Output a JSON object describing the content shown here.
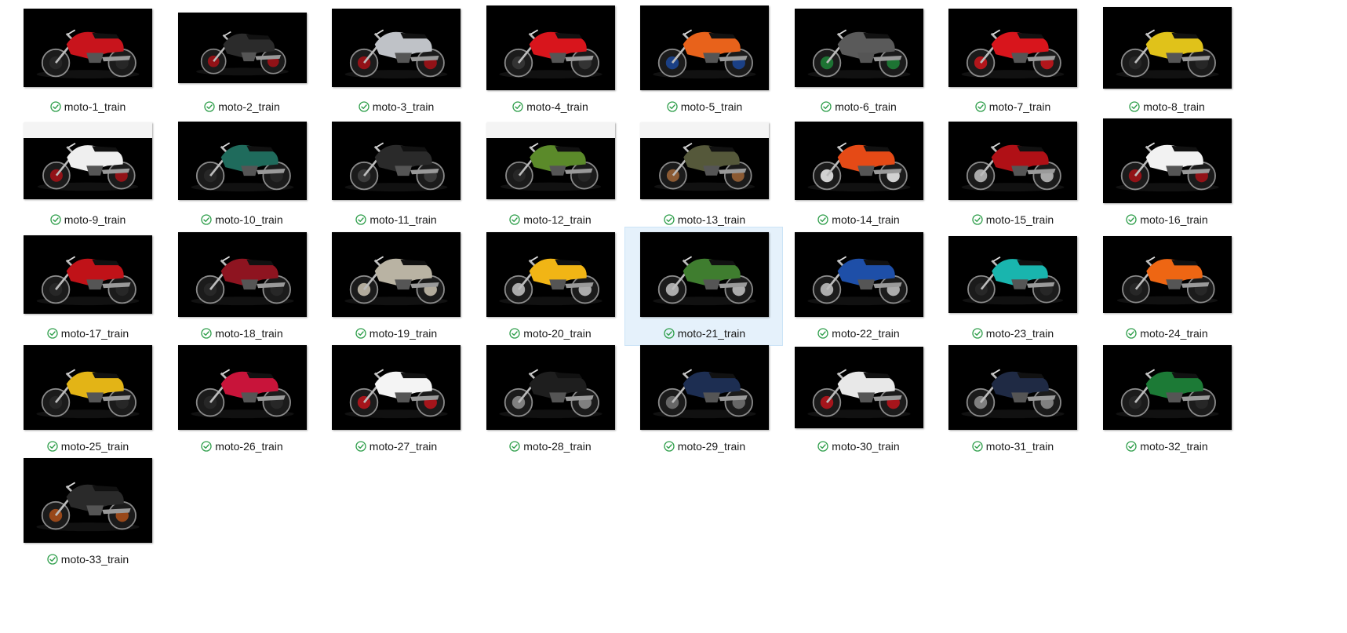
{
  "files": [
    {
      "name": "moto-1_train",
      "accent": "#c8141c",
      "alt": "#2a2a2a"
    },
    {
      "name": "moto-2_train",
      "accent": "#2b2b2b",
      "alt": "#b01016"
    },
    {
      "name": "moto-3_train",
      "accent": "#bfc2c7",
      "alt": "#b01016"
    },
    {
      "name": "moto-4_train",
      "accent": "#d8151c",
      "alt": "#3a3a3a"
    },
    {
      "name": "moto-5_train",
      "accent": "#e8621b",
      "alt": "#1c4aa0"
    },
    {
      "name": "moto-6_train",
      "accent": "#5a5a5a",
      "alt": "#1e8a3a"
    },
    {
      "name": "moto-7_train",
      "accent": "#d8151c",
      "alt": "#d8151c"
    },
    {
      "name": "moto-8_train",
      "accent": "#e0c21a",
      "alt": "#2a2a2a"
    },
    {
      "name": "moto-9_train",
      "accent": "#efefef",
      "alt": "#b01016"
    },
    {
      "name": "moto-10_train",
      "accent": "#1f6b5c",
      "alt": "#2a2a2a"
    },
    {
      "name": "moto-11_train",
      "accent": "#2a2a2a",
      "alt": "#444444"
    },
    {
      "name": "moto-12_train",
      "accent": "#5b8a2a",
      "alt": "#2a2a2a"
    },
    {
      "name": "moto-13_train",
      "accent": "#55583a",
      "alt": "#a86a3a"
    },
    {
      "name": "moto-14_train",
      "accent": "#e54a16",
      "alt": "#ffffff"
    },
    {
      "name": "moto-15_train",
      "accent": "#b01016",
      "alt": "#cccccc"
    },
    {
      "name": "moto-16_train",
      "accent": "#f2f2f2",
      "alt": "#b01016"
    },
    {
      "name": "moto-17_train",
      "accent": "#c01218",
      "alt": "#2a2a2a"
    },
    {
      "name": "moto-18_train",
      "accent": "#8e1420",
      "alt": "#2a2a2a"
    },
    {
      "name": "moto-19_train",
      "accent": "#b9b3a3",
      "alt": "#d8d0bd"
    },
    {
      "name": "moto-20_train",
      "accent": "#f1b515",
      "alt": "#cfcfcf"
    },
    {
      "name": "moto-21_train",
      "accent": "#3f7d2f",
      "alt": "#cfcfcf"
    },
    {
      "name": "moto-22_train",
      "accent": "#1e4fa8",
      "alt": "#cfcfcf"
    },
    {
      "name": "moto-23_train",
      "accent": "#19b5ae",
      "alt": "#2a2a2a"
    },
    {
      "name": "moto-24_train",
      "accent": "#ee6613",
      "alt": "#2a2a2a"
    },
    {
      "name": "moto-25_train",
      "accent": "#e3b416",
      "alt": "#2a2a2a"
    },
    {
      "name": "moto-26_train",
      "accent": "#c8143a",
      "alt": "#2a2a2a"
    },
    {
      "name": "moto-27_train",
      "accent": "#f4f4f4",
      "alt": "#c8141c"
    },
    {
      "name": "moto-28_train",
      "accent": "#1e1e1e",
      "alt": "#9a9a9a"
    },
    {
      "name": "moto-29_train",
      "accent": "#1d2e52",
      "alt": "#7a7a7a"
    },
    {
      "name": "moto-30_train",
      "accent": "#e8e8e8",
      "alt": "#c8141c"
    },
    {
      "name": "moto-31_train",
      "accent": "#1f2a44",
      "alt": "#9a9a9a"
    },
    {
      "name": "moto-32_train",
      "accent": "#1c7a36",
      "alt": "#2a2a2a"
    },
    {
      "name": "moto-33_train",
      "accent": "#2a2a2a",
      "alt": "#b8541a"
    }
  ],
  "selected_file": "moto-21_train",
  "sync_status_color": "#2e9e4a",
  "sync_status_icon": "synced-check-icon",
  "selection_color": "#e5f1fb"
}
